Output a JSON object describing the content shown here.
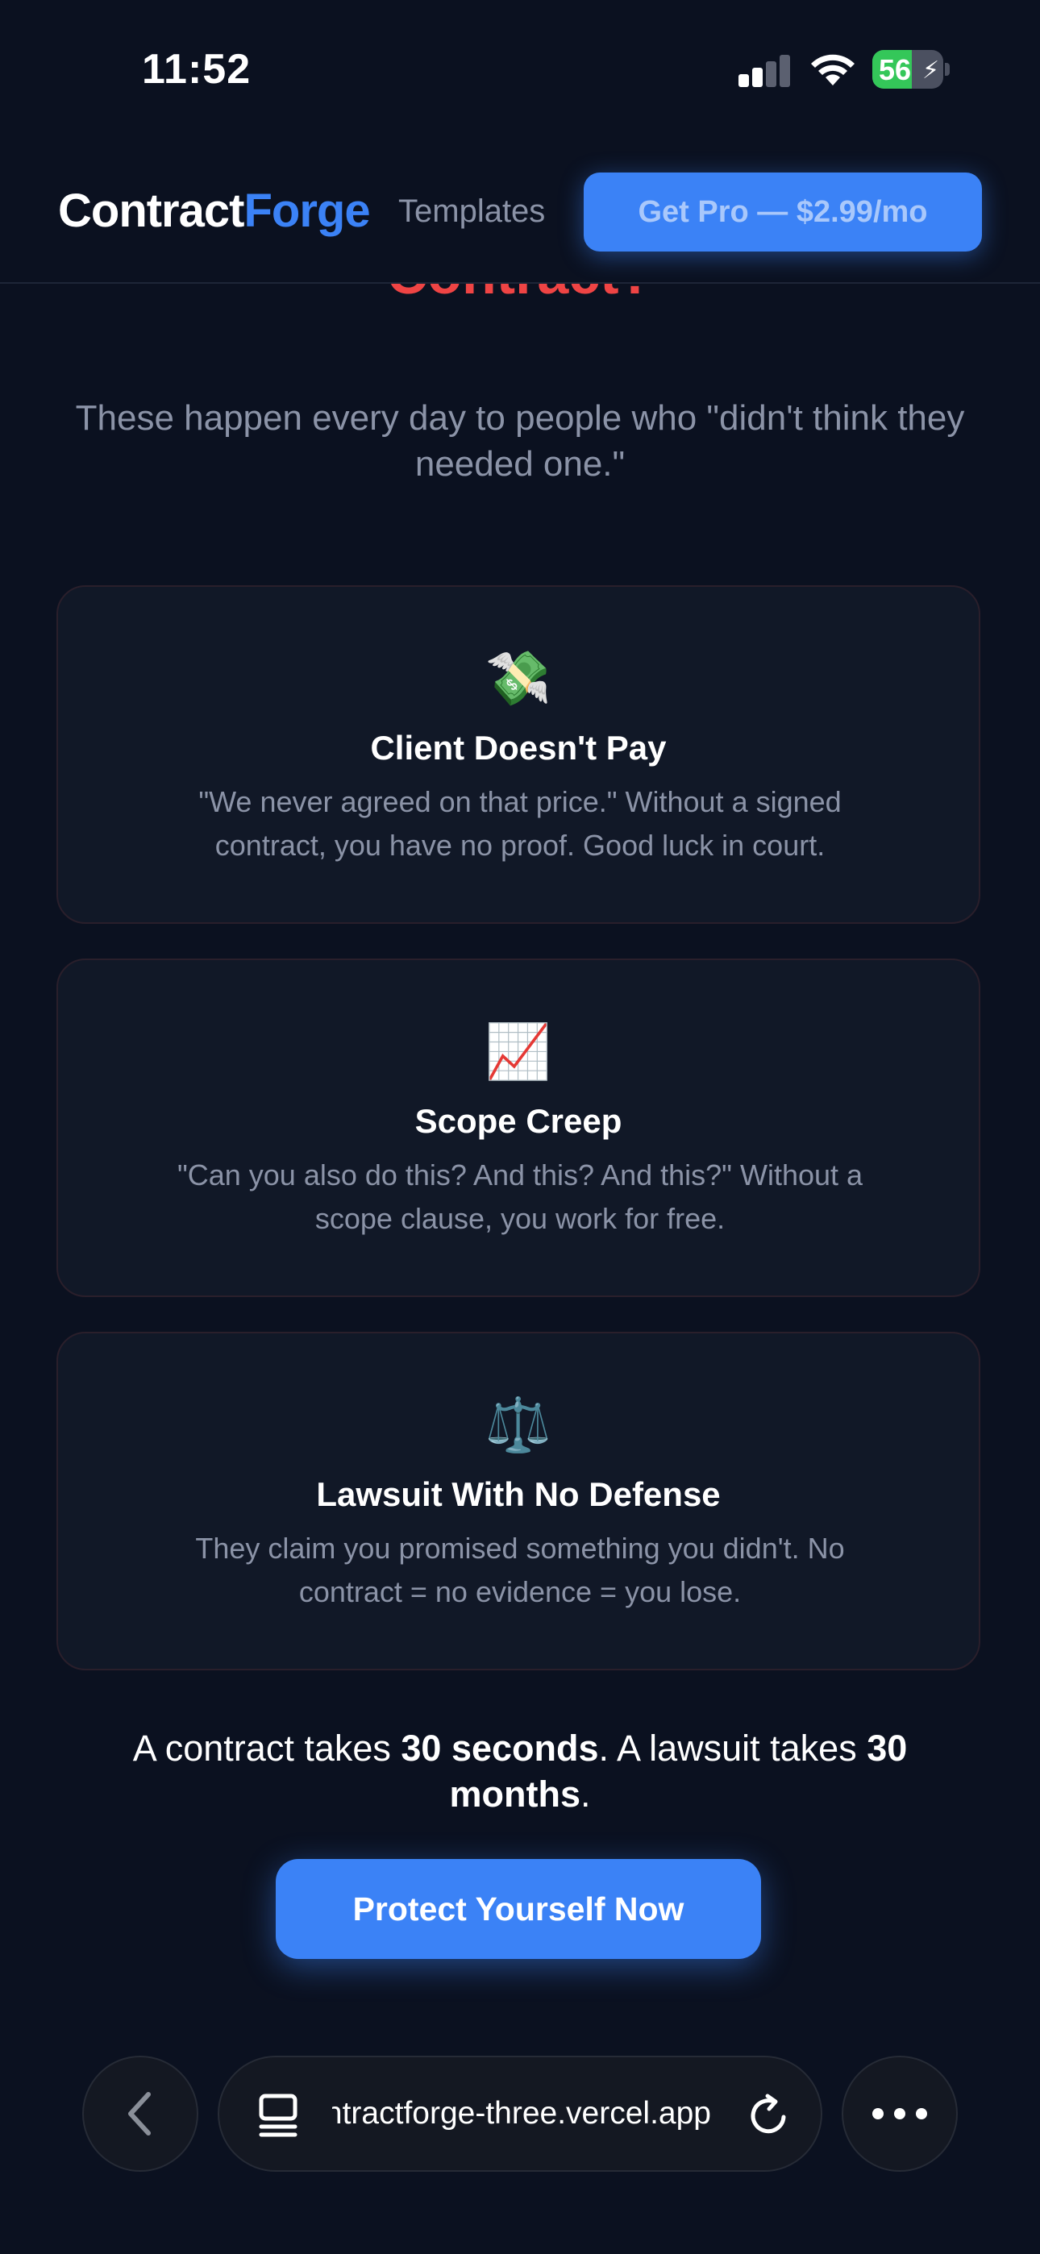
{
  "status_bar": {
    "time": "11:52",
    "battery_level": "56",
    "battery_percent": 56,
    "charging": true
  },
  "header": {
    "logo_part1": "Contract",
    "logo_part2": "Forge",
    "nav_templates": "Templates",
    "get_pro_label": "Get Pro — $2.99/mo"
  },
  "main": {
    "headline_visible": "Contract?",
    "subtitle": "These happen every day to people who \"didn't think they needed one.\"",
    "cards": [
      {
        "icon": "money-with-wings-icon",
        "icon_glyph": "💸",
        "title": "Client Doesn't Pay",
        "description": "\"We never agreed on that price.\" Without a signed contract, you have no proof. Good luck in court."
      },
      {
        "icon": "chart-increasing-icon",
        "icon_glyph": "📈",
        "title": "Scope Creep",
        "description": "\"Can you also do this? And this? And this?\" Without a scope clause, you work for free."
      },
      {
        "icon": "balance-scale-icon",
        "icon_glyph": "⚖️",
        "title": "Lawsuit With No Defense",
        "description": "They claim you promised something you didn't. No contract = no evidence = you lose."
      }
    ],
    "stakes": {
      "part1": "A contract takes ",
      "bold1": "30 seconds",
      "part2": ". A lawsuit takes ",
      "bold2": "30 months",
      "part3": "."
    },
    "cta_label": "Protect Yourself Now"
  },
  "browser": {
    "url": "contractforge-three.vercel.app"
  },
  "colors": {
    "background": "#0b1120",
    "card": "#111827",
    "accent": "#3b82f6",
    "danger": "#ef4444",
    "muted": "#8b93a7"
  }
}
